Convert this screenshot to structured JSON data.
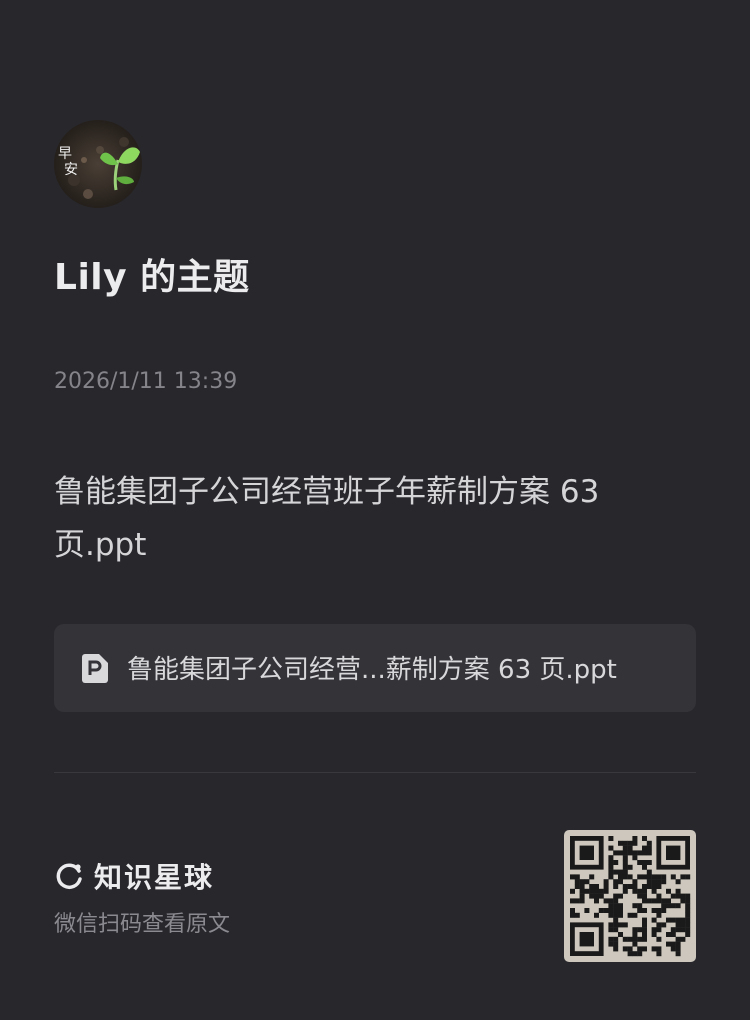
{
  "topic": {
    "title": "Lily 的主题",
    "time": "2026/1/11 13:39"
  },
  "post": {
    "text": "鲁能集团子公司经营班子年薪制方案 63 页.ppt"
  },
  "attachment": {
    "icon": "ppt-file-icon",
    "name": "鲁能集团子公司经营...薪制方案 63 页.ppt"
  },
  "footer": {
    "brand_icon": "zsxq-logo-icon",
    "brand_name": "知识星球",
    "scan_hint": "微信扫码查看原文"
  },
  "colors": {
    "background": "#27272c",
    "card": "#333338",
    "text_primary": "#ececee",
    "text_secondary": "#84848a"
  }
}
